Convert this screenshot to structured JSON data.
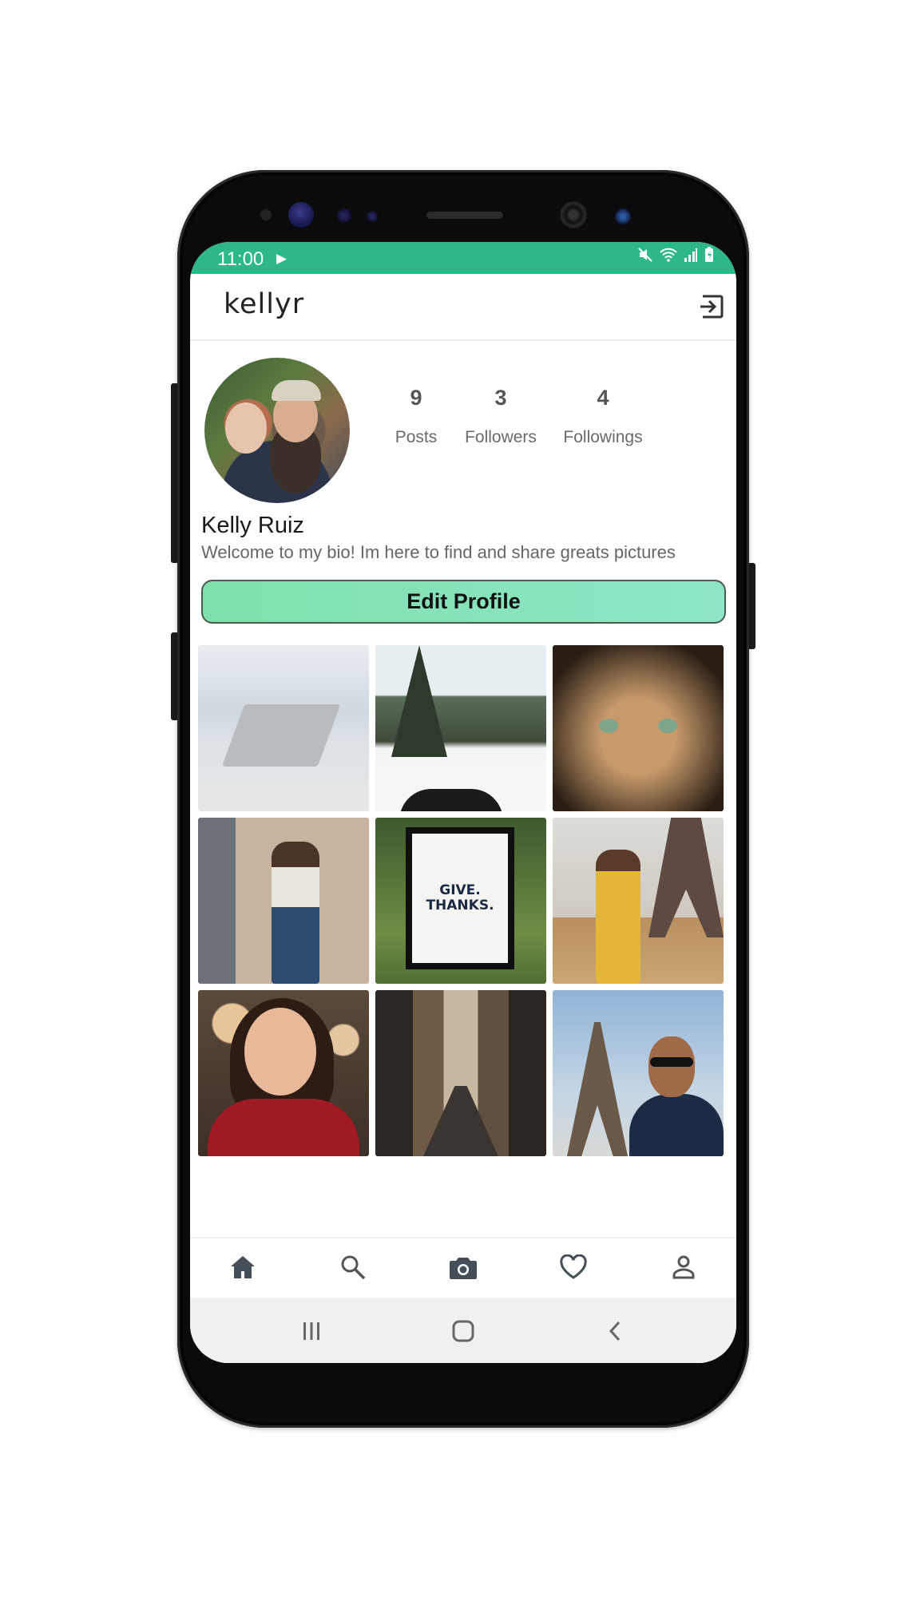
{
  "status_bar": {
    "time": "11:00",
    "background": "#2db889"
  },
  "app_bar": {
    "title": "kellyr",
    "logout_icon": "logout-icon"
  },
  "profile": {
    "name": "Kelly Ruiz",
    "bio": "Welcome to my bio! Im here to find and share greats pictures",
    "stats": [
      {
        "value": "9",
        "label": "Posts"
      },
      {
        "value": "3",
        "label": "Followers"
      },
      {
        "value": "4",
        "label": "Followings"
      }
    ],
    "edit_button_label": "Edit Profile",
    "accent": "#7fe0ac"
  },
  "posts": [
    {
      "name": "post-laptop-bed"
    },
    {
      "name": "post-deer-snow"
    },
    {
      "name": "post-cat"
    },
    {
      "name": "post-woman-running-train"
    },
    {
      "name": "post-give-thanks-sign",
      "text": "GIVE. THANKS."
    },
    {
      "name": "post-woman-eiffel"
    },
    {
      "name": "post-woman-smiling"
    },
    {
      "name": "post-city-street"
    },
    {
      "name": "post-man-eiffel-selfie"
    }
  ],
  "bottom_nav": {
    "items": [
      "home-icon",
      "search-icon",
      "camera-icon",
      "heart-icon",
      "profile-icon"
    ]
  },
  "system_nav": {
    "items": [
      "recents-icon",
      "home-button-icon",
      "back-icon"
    ]
  }
}
